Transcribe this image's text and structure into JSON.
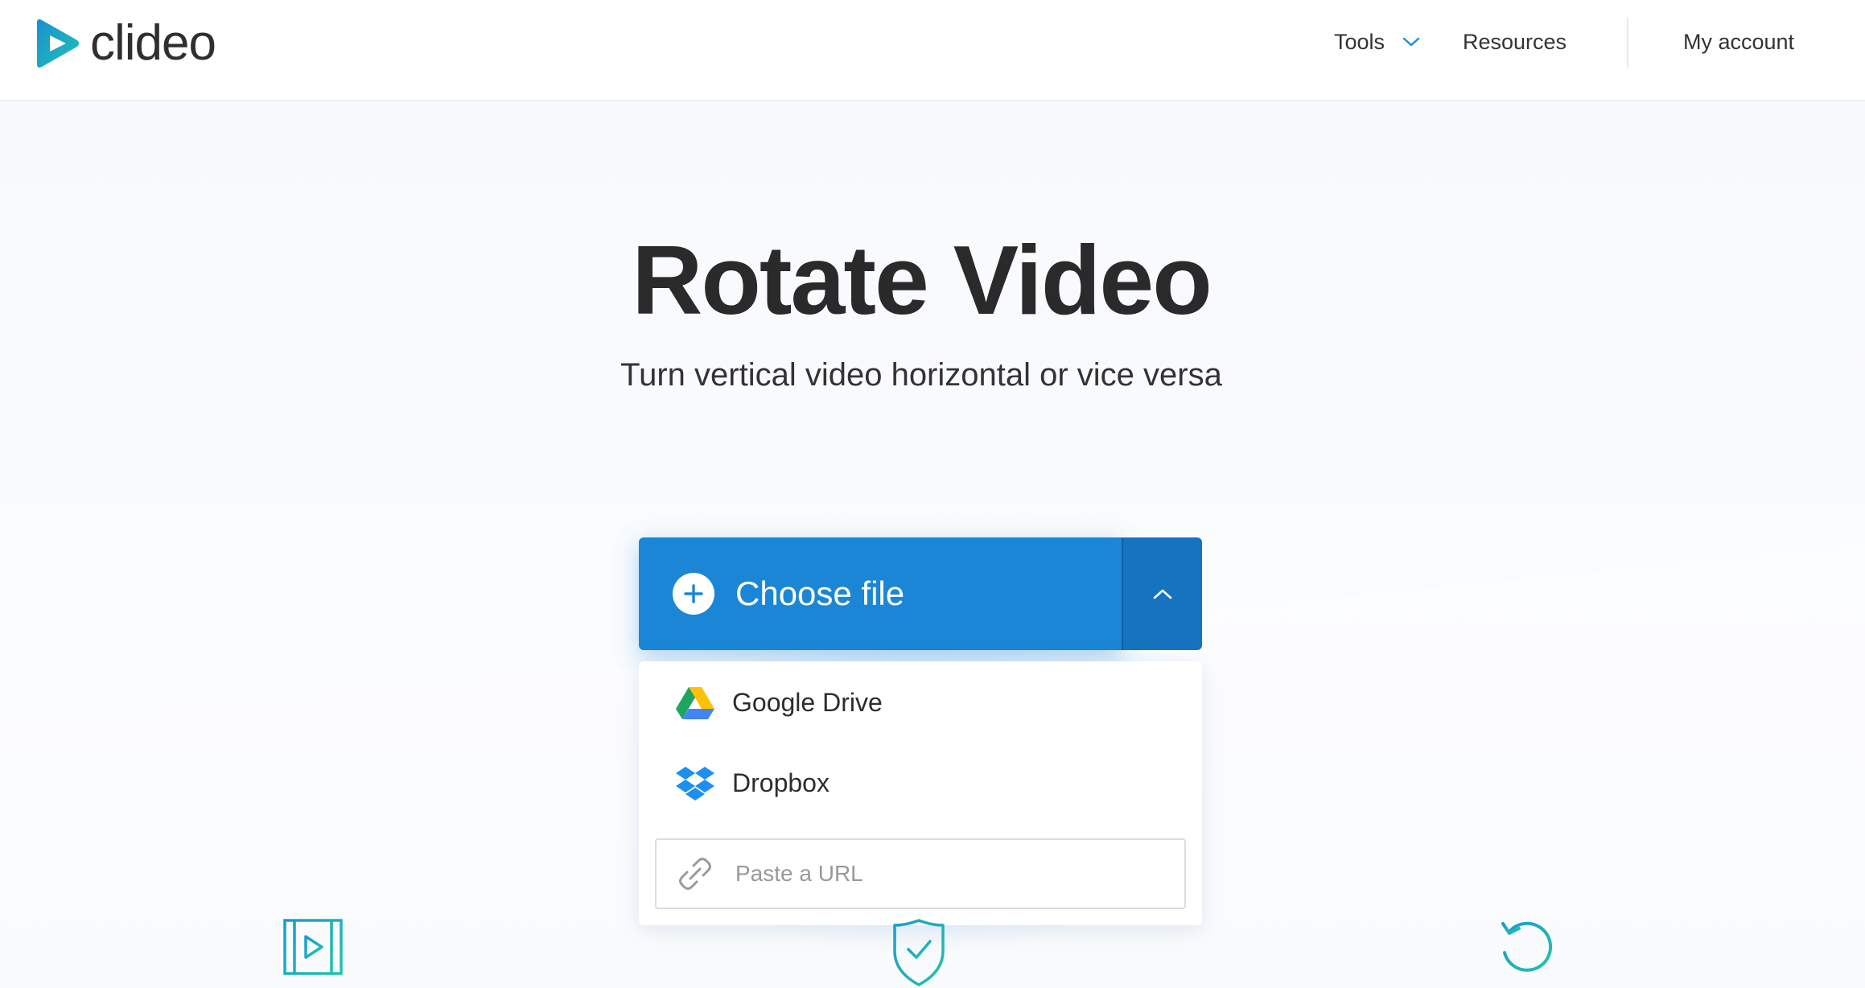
{
  "header": {
    "logo_text": "clideo",
    "nav": {
      "tools_label": "Tools",
      "resources_label": "Resources",
      "account_label": "My account"
    }
  },
  "hero": {
    "title": "Rotate Video",
    "subtitle": "Turn vertical video horizontal or vice versa"
  },
  "upload": {
    "choose_label": "Choose file",
    "dropdown_open": true,
    "options": [
      {
        "label": "Google Drive",
        "icon": "google-drive-icon"
      },
      {
        "label": "Dropbox",
        "icon": "dropbox-icon"
      }
    ],
    "url_placeholder": "Paste a URL",
    "url_value": ""
  },
  "features": {
    "icons": [
      "video-play-icon",
      "shield-check-icon",
      "rotate-icon"
    ]
  },
  "colors": {
    "accent": "#1b86d6",
    "accent_dark": "#1673c0",
    "brand_teal": "#20c2b0",
    "brand_blue": "#1a8fd4"
  }
}
